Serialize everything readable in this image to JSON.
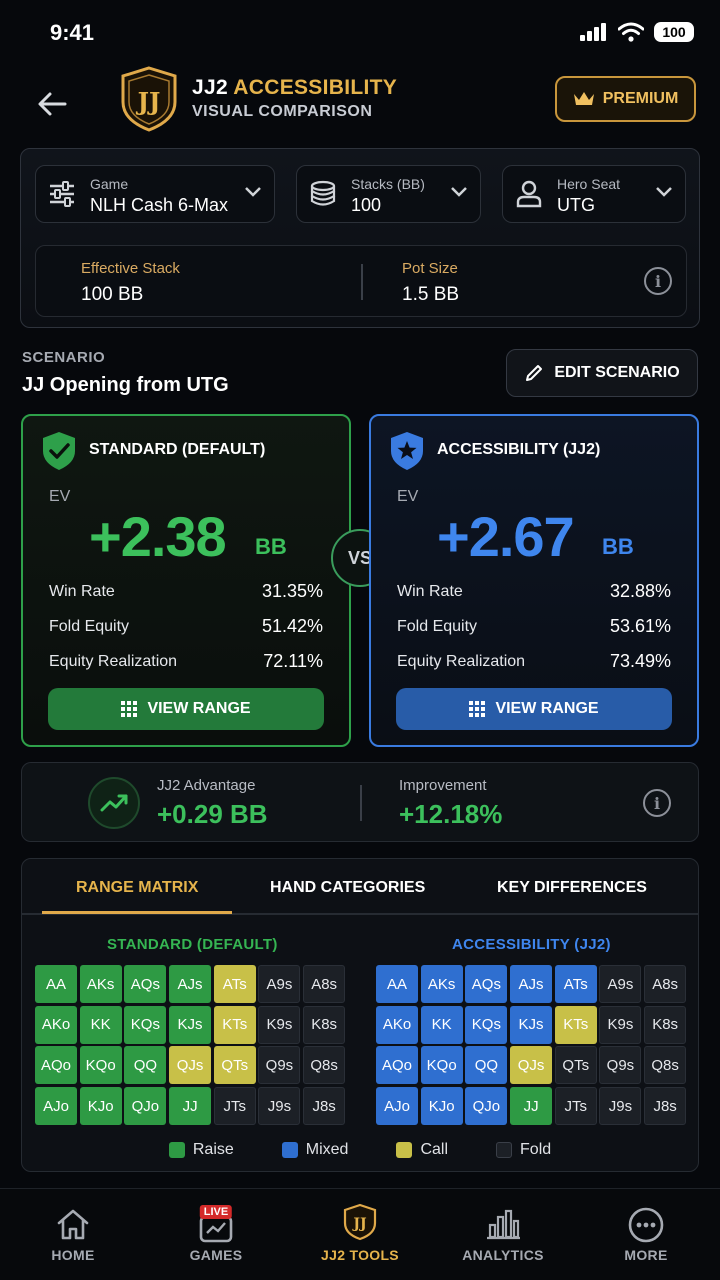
{
  "status_bar": {
    "time": "9:41",
    "battery": "100"
  },
  "header": {
    "title_prefix": "JJ2 ",
    "title_accent": "ACCESSIBILITY",
    "subtitle": "VISUAL COMPARISON",
    "logo_text": "JJ",
    "premium_label": "PREMIUM"
  },
  "settings": {
    "game": {
      "label": "Game",
      "value": "NLH Cash 6-Max"
    },
    "stacks": {
      "label": "Stacks (BB)",
      "value": "100"
    },
    "seat": {
      "label": "Hero Seat",
      "value": "UTG"
    },
    "effective_stack": {
      "label": "Effective Stack",
      "value": "100 BB"
    },
    "pot_size": {
      "label": "Pot Size",
      "value": "1.5 BB"
    }
  },
  "scenario": {
    "label": "SCENARIO",
    "title": "JJ Opening from UTG",
    "edit_label": "EDIT SCENARIO"
  },
  "standard": {
    "heading": "STANDARD (DEFAULT)",
    "ev_label": "EV",
    "ev_value": "+2.38",
    "ev_unit": "BB",
    "stats": [
      {
        "name": "Win Rate",
        "value": "31.35%"
      },
      {
        "name": "Fold Equity",
        "value": "51.42%"
      },
      {
        "name": "Equity Realization",
        "value": "72.11%"
      }
    ],
    "range_button": "VIEW RANGE"
  },
  "accessibility": {
    "heading": "ACCESSIBILITY (JJ2)",
    "ev_label": "EV",
    "ev_value": "+2.67",
    "ev_unit": "BB",
    "stats": [
      {
        "name": "Win Rate",
        "value": "32.88%"
      },
      {
        "name": "Fold Equity",
        "value": "53.61%"
      },
      {
        "name": "Equity Realization",
        "value": "73.49%"
      }
    ],
    "range_button": "VIEW RANGE"
  },
  "vs_label": "VS",
  "advantage": {
    "label": "JJ2 Advantage",
    "value": "+0.29 BB",
    "improvement_label": "Improvement",
    "improvement_value": "+12.18%"
  },
  "matrix": {
    "tabs": [
      "RANGE MATRIX",
      "HAND CATEGORIES",
      "KEY DIFFERENCES"
    ],
    "active_tab": 0,
    "standard_title": "STANDARD (DEFAULT)",
    "accessibility_title": "ACCESSIBILITY (JJ2)",
    "standard_grid": [
      [
        [
          "AA",
          "raise"
        ],
        [
          "AKs",
          "raise"
        ],
        [
          "AQs",
          "raise"
        ],
        [
          "AJs",
          "raise"
        ],
        [
          "ATs",
          "call"
        ],
        [
          "A9s",
          "fold"
        ],
        [
          "A8s",
          "fold"
        ]
      ],
      [
        [
          "AKo",
          "raise"
        ],
        [
          "KK",
          "raise"
        ],
        [
          "KQs",
          "raise"
        ],
        [
          "KJs",
          "raise"
        ],
        [
          "KTs",
          "call"
        ],
        [
          "K9s",
          "fold"
        ],
        [
          "K8s",
          "fold"
        ]
      ],
      [
        [
          "AQo",
          "raise"
        ],
        [
          "KQo",
          "raise"
        ],
        [
          "QQ",
          "raise"
        ],
        [
          "QJs",
          "call"
        ],
        [
          "QTs",
          "call"
        ],
        [
          "Q9s",
          "fold"
        ],
        [
          "Q8s",
          "fold"
        ]
      ],
      [
        [
          "AJo",
          "raise"
        ],
        [
          "KJo",
          "raise"
        ],
        [
          "QJo",
          "raise"
        ],
        [
          "JJ",
          "raise"
        ],
        [
          "JTs",
          "fold"
        ],
        [
          "J9s",
          "fold"
        ],
        [
          "J8s",
          "fold"
        ]
      ]
    ],
    "accessibility_grid": [
      [
        [
          "AA",
          "mixed"
        ],
        [
          "AKs",
          "mixed"
        ],
        [
          "AQs",
          "mixed"
        ],
        [
          "AJs",
          "mixed"
        ],
        [
          "ATs",
          "mixed"
        ],
        [
          "A9s",
          "fold"
        ],
        [
          "A8s",
          "fold"
        ]
      ],
      [
        [
          "AKo",
          "mixed"
        ],
        [
          "KK",
          "mixed"
        ],
        [
          "KQs",
          "mixed"
        ],
        [
          "KJs",
          "mixed"
        ],
        [
          "KTs",
          "call"
        ],
        [
          "K9s",
          "fold"
        ],
        [
          "K8s",
          "fold"
        ]
      ],
      [
        [
          "AQo",
          "mixed"
        ],
        [
          "KQo",
          "mixed"
        ],
        [
          "QQ",
          "mixed"
        ],
        [
          "QJs",
          "call"
        ],
        [
          "QTs",
          "fold"
        ],
        [
          "Q9s",
          "fold"
        ],
        [
          "Q8s",
          "fold"
        ]
      ],
      [
        [
          "AJo",
          "mixed"
        ],
        [
          "KJo",
          "mixed"
        ],
        [
          "QJo",
          "mixed"
        ],
        [
          "JJ",
          "raise"
        ],
        [
          "JTs",
          "fold"
        ],
        [
          "J9s",
          "fold"
        ],
        [
          "J8s",
          "fold"
        ]
      ]
    ],
    "legend": [
      {
        "key": "raise",
        "label": "Raise",
        "color": "#2e9a44"
      },
      {
        "key": "mixed",
        "label": "Mixed",
        "color": "#2f6fd0"
      },
      {
        "key": "call",
        "label": "Call",
        "color": "#c8c048"
      },
      {
        "key": "fold",
        "label": "Fold",
        "color": "#1c2026"
      }
    ]
  },
  "nav": {
    "items": [
      {
        "label": "HOME",
        "icon": "home-icon"
      },
      {
        "label": "GAMES",
        "icon": "games-icon",
        "badge": "LIVE"
      },
      {
        "label": "JJ2 TOOLS",
        "icon": "jj-logo-icon",
        "active": true
      },
      {
        "label": "ANALYTICS",
        "icon": "analytics-icon"
      },
      {
        "label": "MORE",
        "icon": "more-icon"
      }
    ]
  },
  "colors": {
    "accent_gold": "#e6b44c",
    "standard_green": "#2ea04a",
    "ev_green": "#3cc05c",
    "accessibility_blue": "#3a7be0",
    "ev_blue": "#3f86ee"
  }
}
